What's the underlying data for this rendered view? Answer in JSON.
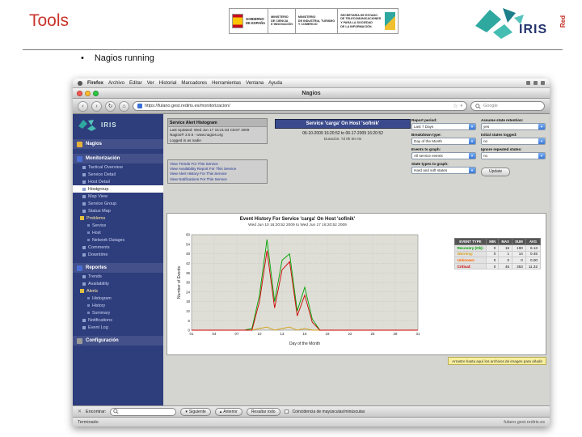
{
  "slide": {
    "title": "Tools",
    "bullet": "Nagios running"
  },
  "logos": {
    "gobierno": {
      "line1": "GOBIERNO",
      "line2": "DE ESPAÑA"
    },
    "ciencia": [
      "MINISTERIO",
      "DE CIENCIA",
      "E INNOVACIÓN"
    ],
    "industria": [
      "MINISTERIO",
      "DE INDUSTRIA, TURISMO",
      "Y COMERCIO"
    ],
    "secretaria": [
      "SECRETARÍA DE ESTADO",
      "DE TELECOMUNICACIONES",
      "Y PARA LA SOCIEDAD",
      "DE LA INFORMACIÓN"
    ],
    "rediris": {
      "red": "Red",
      "iris": "IRIS"
    }
  },
  "browser": {
    "menubar": {
      "items": [
        "Firefox",
        "Archivo",
        "Editar",
        "Ver",
        "Historial",
        "Marcadores",
        "Herramientas",
        "Ventana",
        "Ayuda"
      ]
    },
    "window_title": "Nagios",
    "toolbar": {
      "url": "https://fulano.gest.rediris.es/monitorizacion/",
      "search": "Google"
    },
    "findbar": {
      "label": "Encontrar:",
      "next": "Siguiente",
      "prev": "Anterior",
      "highlight": "Resaltar todo",
      "case": "Coincidencia de mayúsculas/minúsculas"
    },
    "statusbar": {
      "status": "Terminado",
      "host": "fulano.gest.rediris.es"
    },
    "notice": "Arrastre hasta aquí los archivos de imagen para añadir"
  },
  "nagios": {
    "sidebar": {
      "brand": "IRIS",
      "items": [
        {
          "type": "section",
          "label": "Nagios",
          "icon": "#e8b23a"
        },
        {
          "type": "section",
          "label": "Monitorización",
          "icon": "#4a6fd4"
        },
        {
          "type": "link",
          "label": "Tactical Overview"
        },
        {
          "type": "link",
          "label": "Service Detail"
        },
        {
          "type": "link",
          "label": "Host Detail"
        },
        {
          "type": "link",
          "label": "Hostgroup",
          "selected": true
        },
        {
          "type": "link",
          "label": "Map View"
        },
        {
          "type": "link",
          "label": "Service Group"
        },
        {
          "type": "link",
          "label": "Status Map"
        },
        {
          "type": "group",
          "label": "Problems",
          "icon": "#e0c040"
        },
        {
          "type": "sublink",
          "label": "Service"
        },
        {
          "type": "sublink",
          "label": "Host"
        },
        {
          "type": "sublink",
          "label": "Network Outages"
        },
        {
          "type": "link",
          "label": "Comments"
        },
        {
          "type": "link",
          "label": "Downtime"
        },
        {
          "type": "section",
          "label": "Reportes",
          "icon": "#4a6fd4"
        },
        {
          "type": "link",
          "label": "Trends"
        },
        {
          "type": "link",
          "label": "Availability"
        },
        {
          "type": "group",
          "label": "Alerts",
          "icon": "#e0c040"
        },
        {
          "type": "sublink",
          "label": "Histogram"
        },
        {
          "type": "sublink",
          "label": "History"
        },
        {
          "type": "sublink",
          "label": "Summary"
        },
        {
          "type": "link",
          "label": "Notifications"
        },
        {
          "type": "link",
          "label": "Event Log"
        },
        {
          "type": "section",
          "label": "Configuración",
          "icon": "#9a9a9a"
        }
      ]
    },
    "info": {
      "title": "Service Alert Histogram",
      "updated": "Last Updated: Wed Jun 17 15:21:53 CEST 2009",
      "version": "Nagios® 3.0.6 - www.nagios.org",
      "user": "Logged in as nadie"
    },
    "links": [
      "View Trends For This Service",
      "View Availability Report For This Service",
      "View Alert History For This Service",
      "View Notifications For This Service"
    ],
    "header": {
      "title": "Service 'carga' On Host 'sofinik'",
      "range": "06-10-2009 16:20:52 to 06-17-2009 16:20:52",
      "duration": "Duración: 7d 0h 0m 0s"
    },
    "controls": [
      {
        "label": "Report period:",
        "value": "Last 7 Days"
      },
      {
        "label": "Assume state retention:",
        "value": "yes"
      },
      {
        "label": "Breakdown type:",
        "value": "Day of the Month"
      },
      {
        "label": "Initial states logged:",
        "value": "no"
      },
      {
        "label": "Events to graph:",
        "value": "All service events"
      },
      {
        "label": "Ignore repeated states:",
        "value": "no"
      },
      {
        "label": "State types to graph:",
        "value": "Hard and soft states"
      }
    ],
    "update_button": "Update"
  },
  "chart_data": {
    "type": "line",
    "title": "Event History For Service 'carga' On Host 'sofinik'",
    "subtitle": "Wed Jun 10 16:20:52 2009 to Wed Jun 17 16:20:52 2009",
    "xlabel": "Day of the Month",
    "ylabel": "Number of Events",
    "ylim": [
      0,
      60
    ],
    "ytick": 6,
    "x": [
      1,
      2,
      3,
      4,
      5,
      6,
      7,
      8,
      9,
      10,
      11,
      12,
      13,
      14,
      15,
      16,
      17,
      18,
      19,
      20,
      21,
      22,
      23,
      24,
      25,
      26,
      27,
      28,
      29,
      30,
      31
    ],
    "series": [
      {
        "name": "Recovery (Ok)",
        "color": "#00a000",
        "values": [
          0,
          0,
          0,
          0,
          0,
          0,
          0,
          0,
          1,
          22,
          57,
          18,
          44,
          48,
          12,
          27,
          7,
          0,
          0,
          0,
          0,
          0,
          0,
          0,
          0,
          0,
          0,
          0,
          0,
          0,
          0
        ]
      },
      {
        "name": "Warning",
        "color": "#d4a017",
        "values": [
          0,
          0,
          0,
          0,
          0,
          0,
          0,
          0,
          0,
          1,
          2,
          0,
          1,
          2,
          0,
          1,
          0,
          0,
          0,
          0,
          0,
          0,
          0,
          0,
          0,
          0,
          0,
          0,
          0,
          0,
          0
        ]
      },
      {
        "name": "Critical",
        "color": "#cc0000",
        "values": [
          0,
          0,
          0,
          0,
          0,
          0,
          0,
          0,
          0,
          18,
          50,
          14,
          38,
          43,
          9,
          22,
          5,
          0,
          0,
          0,
          0,
          0,
          0,
          0,
          0,
          0,
          0,
          0,
          0,
          0,
          0
        ]
      }
    ],
    "legend": {
      "headers": [
        "EVENT TYPE",
        "MIN",
        "MAX",
        "SUM",
        "AVG"
      ],
      "rows": [
        {
          "label": "Recovery (Ok):",
          "color": "#00a000",
          "min": "0",
          "max": "16",
          "sum": "190",
          "avg": "6.13"
        },
        {
          "label": "Warning:",
          "color": "#d4a017",
          "min": "0",
          "max": "1",
          "sum": "14",
          "avg": "0.45"
        },
        {
          "label": "Unknown:",
          "color": "#ff6600",
          "min": "0",
          "max": "0",
          "sum": "0",
          "avg": "0.00"
        },
        {
          "label": "Critical:",
          "color": "#cc0000",
          "min": "0",
          "max": "45",
          "sum": "353",
          "avg": "11.32"
        }
      ]
    }
  }
}
